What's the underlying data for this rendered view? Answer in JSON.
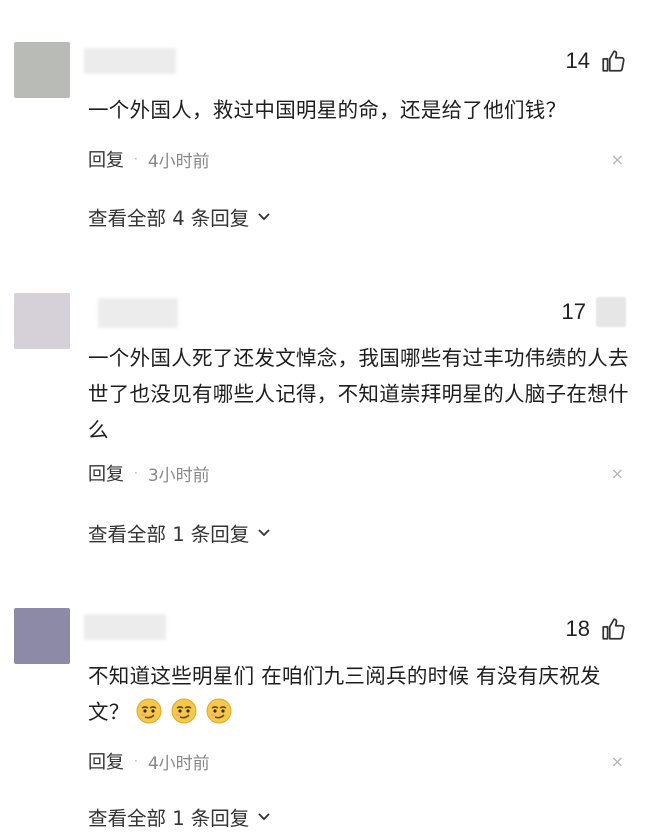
{
  "comments": [
    {
      "likes": "14",
      "text": "一个外国人，救过中国明星的命，还是给了他们钱？",
      "reply_label": "回复",
      "time": "4小时前",
      "view_replies": "查看全部 4 条回复",
      "avatar_color": "#b9bbb6"
    },
    {
      "likes": "17",
      "text": "一个外国人死了还发文悼念，我国哪些有过丰功伟绩的人去世了也没见有哪些人记得，不知道崇拜明星的人脑子在想什么",
      "reply_label": "回复",
      "time": "3小时前",
      "view_replies": "查看全部 1 条回复",
      "avatar_color": "#d6d1d8"
    },
    {
      "likes": "18",
      "text": "不知道这些明星们 在咱们九三阅兵的时候 有没有庆祝发文？",
      "reply_label": "回复",
      "time": "4小时前",
      "view_replies": "查看全部 1 条回复",
      "avatar_color": "#8c8aa6"
    }
  ],
  "icons": {
    "like": "thumbs-up-icon",
    "close": "close-icon",
    "expand": "chevron-down-icon",
    "emoji": "smirk-emoji-icon"
  },
  "separator": "·",
  "close_glyph": "×"
}
